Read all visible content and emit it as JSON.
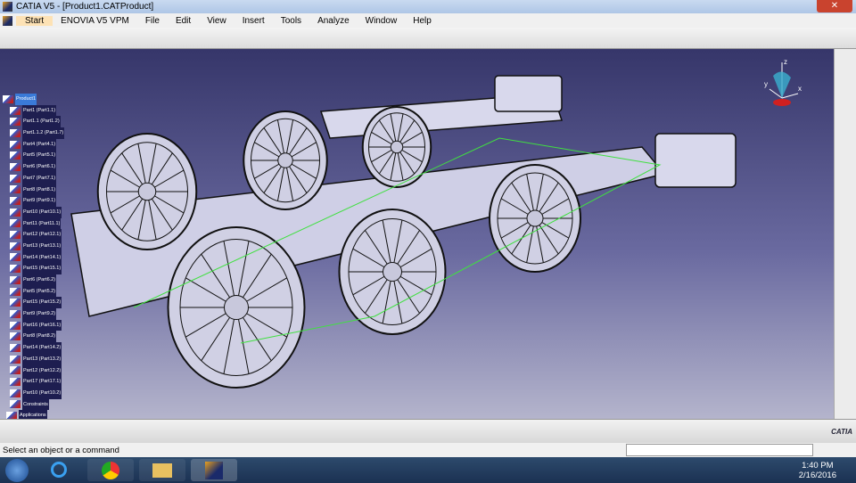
{
  "window": {
    "title": "CATIA V5 - [Product1.CATProduct]",
    "close": "✕"
  },
  "menu": [
    "Start",
    "ENOVIA V5 VPM",
    "File",
    "Edit",
    "View",
    "Insert",
    "Tools",
    "Analyze",
    "Window",
    "Help"
  ],
  "tree": [
    "Product1",
    "Part1 (Part1.1)",
    "Part1.1 (Part1.2)",
    "Part1.1.2 (Part1.7)",
    "Part4 (Part4.1)",
    "Part5 (Part5.1)",
    "Part6 (Part6.1)",
    "Part7 (Part7.1)",
    "Part8 (Part8.1)",
    "Part9 (Part9.1)",
    "Part10 (Part10.1)",
    "Part11 (Part11.1)",
    "Part12 (Part12.1)",
    "Part13 (Part13.1)",
    "Part14 (Part14.1)",
    "Part15 (Part15.1)",
    "Part6 (Part6.2)",
    "Part5 (Part5.2)",
    "Part15 (Part15.2)",
    "Part9 (Part9.2)",
    "Part16 (Part16.1)",
    "Part8 (Part8.2)",
    "Part14 (Part14.2)",
    "Part13 (Part13.2)",
    "Part12 (Part12.2)",
    "Part17 (Part17.1)",
    "Part10 (Part10.2)",
    "Constraints",
    "Applications"
  ],
  "compass": {
    "x": "x",
    "y": "y",
    "z": "z"
  },
  "status": {
    "prompt": "Select an object or a command",
    "cmd_value": ""
  },
  "brand": "CATIA",
  "clock": {
    "time": "1:40 PM",
    "date": "2/16/2016"
  }
}
